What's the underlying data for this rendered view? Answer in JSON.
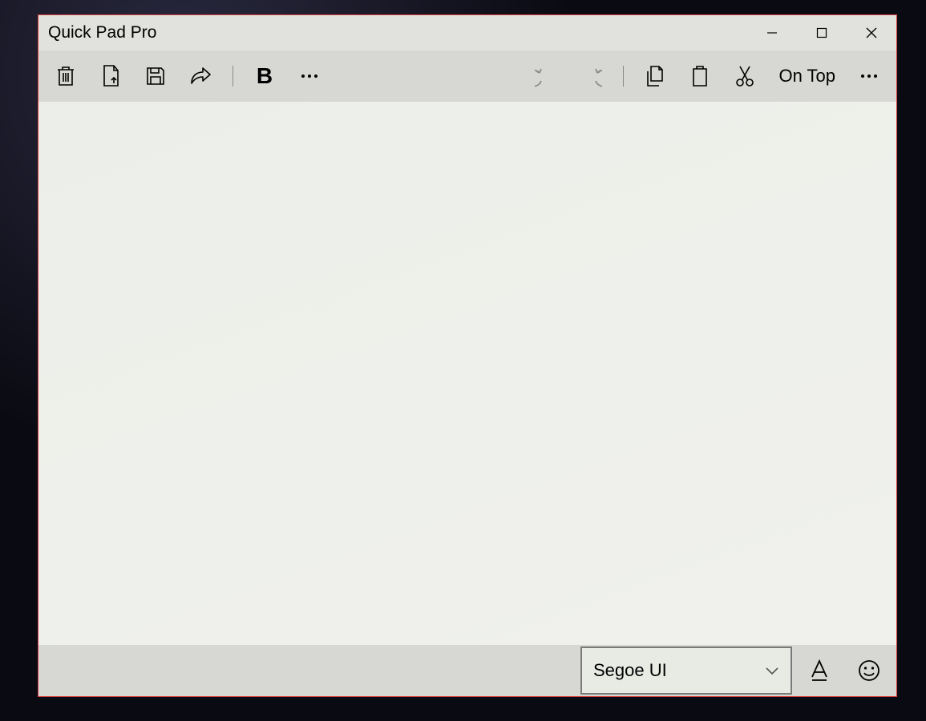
{
  "window": {
    "title": "Quick Pad Pro"
  },
  "toolbar": {
    "bold_label": "B",
    "on_top_label": "On Top"
  },
  "statusbar": {
    "font_selected": "Segoe UI"
  },
  "icons": {
    "trash": "trash",
    "open": "open",
    "save": "save",
    "share": "share",
    "more": "more",
    "undo": "undo",
    "redo": "redo",
    "copy": "copy",
    "paste": "paste",
    "cut": "cut",
    "font_size": "font_size",
    "emoji": "emoji",
    "chevron": "chevron"
  }
}
